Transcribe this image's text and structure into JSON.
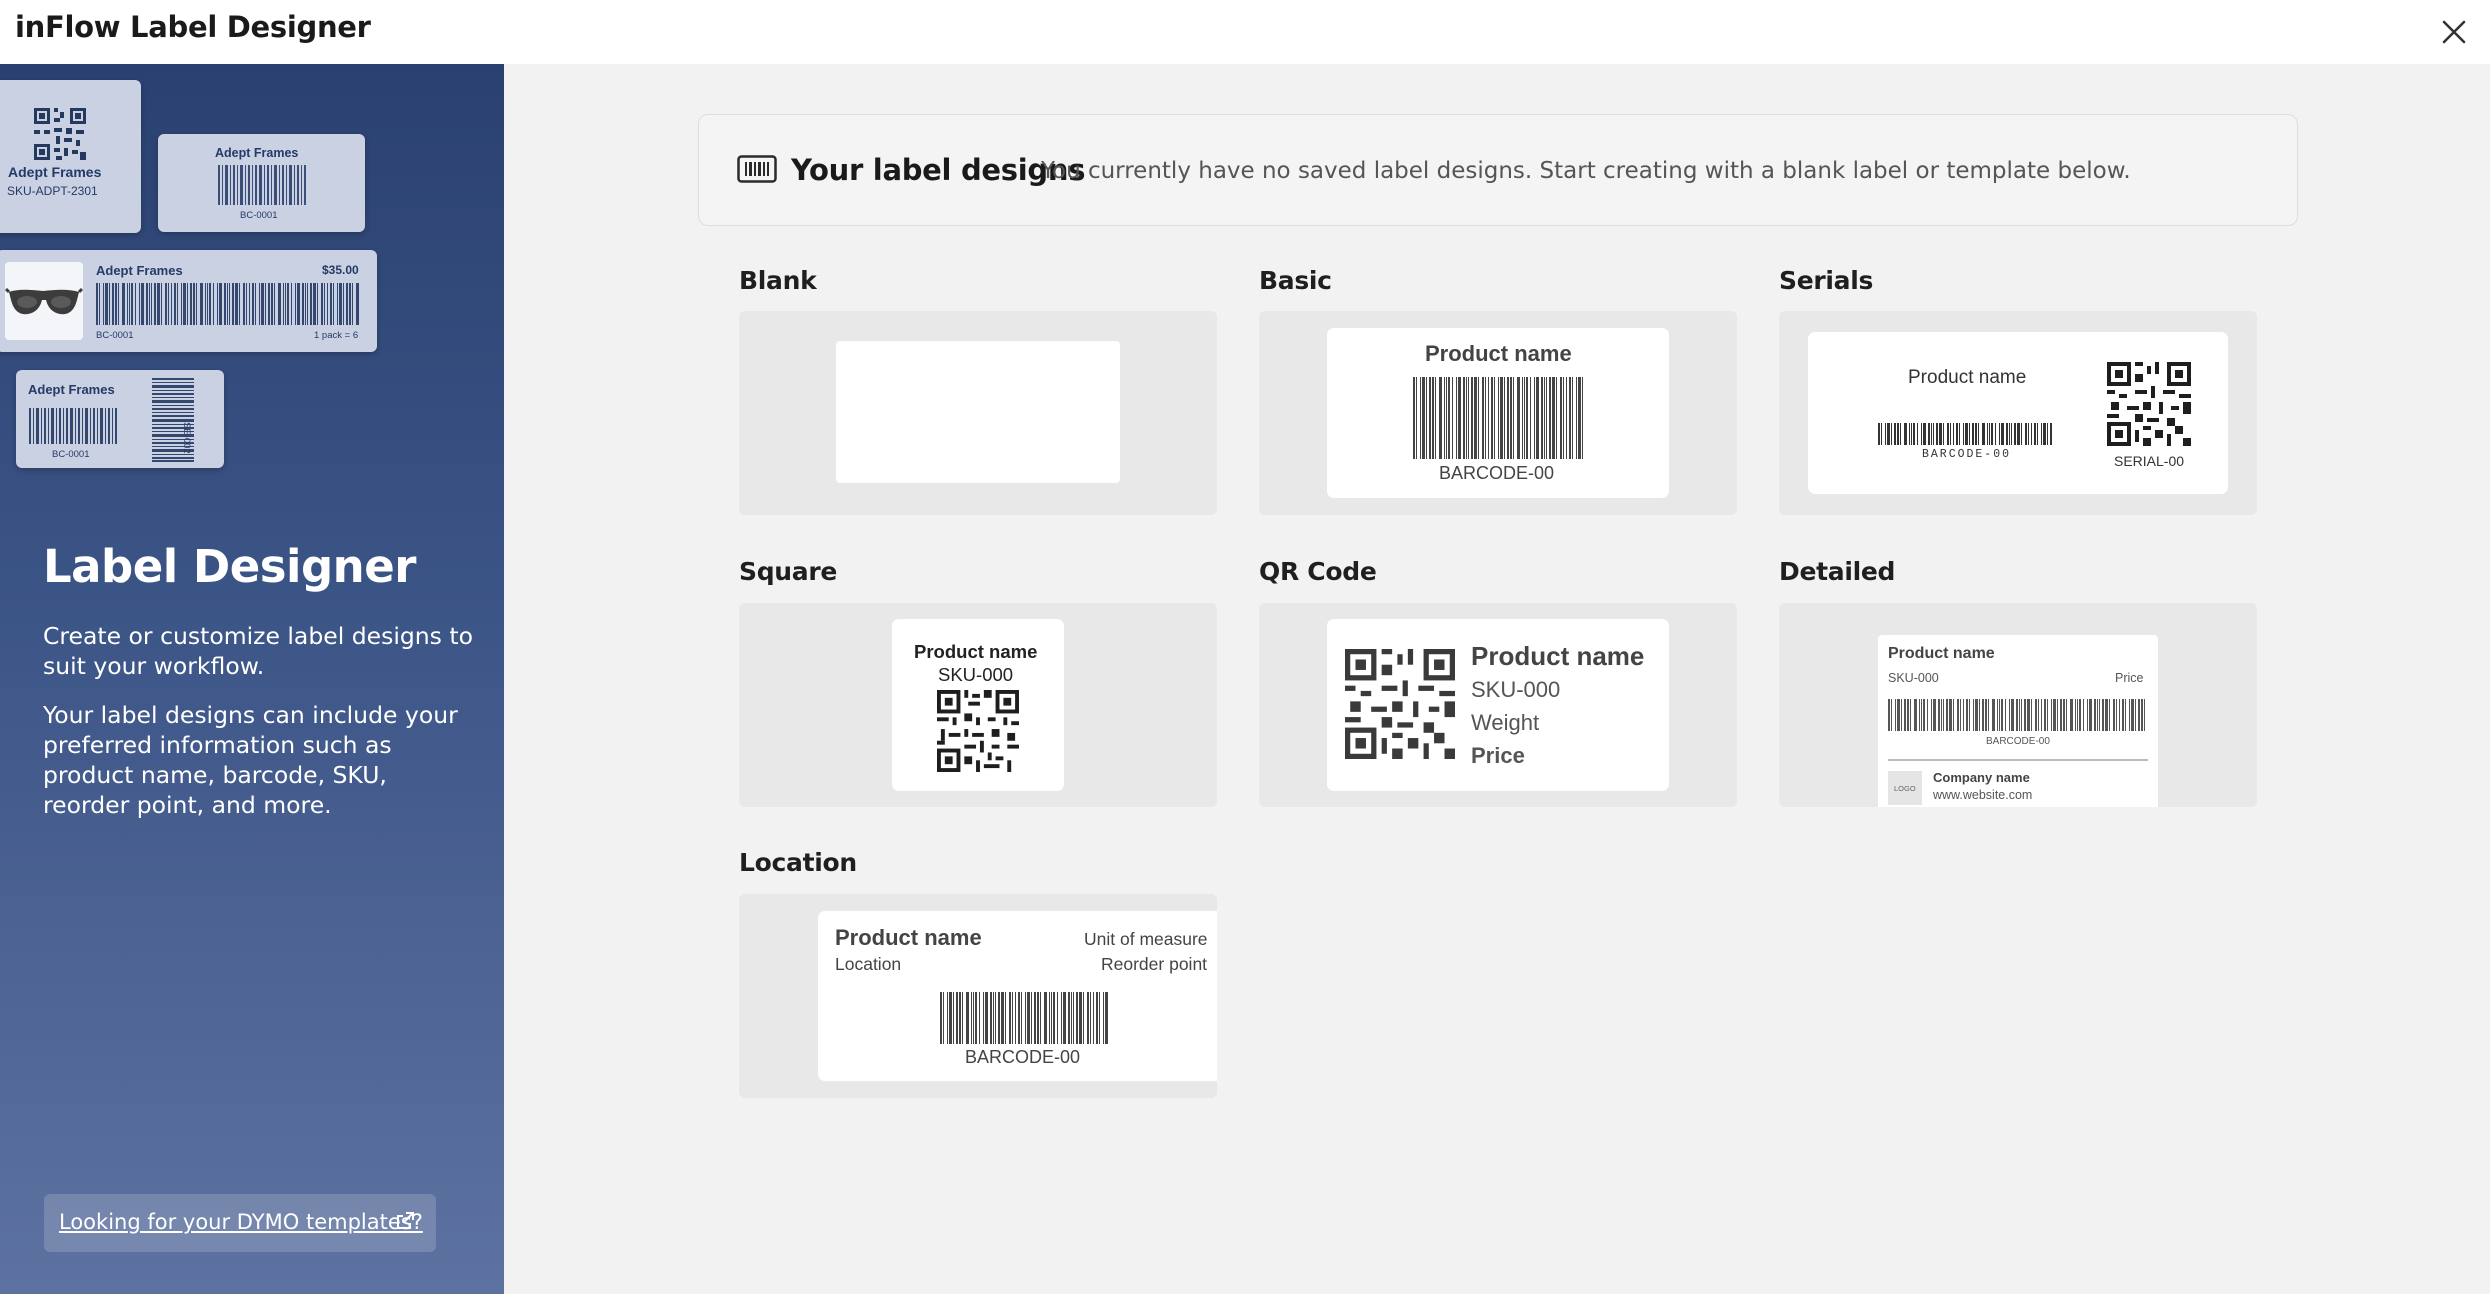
{
  "app": {
    "title": "inFlow Label Designer"
  },
  "icons": {
    "close": "close-icon",
    "barcode": "barcode-icon",
    "external_link": "external-link-icon"
  },
  "sidebar": {
    "preview_labels": {
      "qr_label": {
        "name": "Adept Frames",
        "sku": "SKU-ADPT-2301"
      },
      "barcode_label": {
        "name": "Adept Frames",
        "code": "BC-0001"
      },
      "price_label": {
        "name": "Adept Frames",
        "price": "$35.00",
        "code": "BC-0001",
        "pack": "1 pack = 6"
      },
      "vertical_label": {
        "name": "Adept Frames",
        "code": "BC-0001",
        "side_code": "SE-002"
      }
    },
    "title": "Label Designer",
    "description_1": "Create or customize label designs to suit your workflow.",
    "description_2": "Your label designs can include your preferred information such as product name, barcode, SKU, reorder point, and more.",
    "dymo_link": "Looking for your DYMO templates?"
  },
  "banner": {
    "title": "Your label designs",
    "subtitle": "You currently have no saved label designs. Start creating with a blank label or template below."
  },
  "templates": {
    "blank": {
      "title": "Blank"
    },
    "basic": {
      "title": "Basic",
      "product": "Product name",
      "barcode": "BARCODE-00"
    },
    "serials": {
      "title": "Serials",
      "product": "Product name",
      "barcode": "BARCODE-00",
      "serial": "SERIAL-00"
    },
    "square": {
      "title": "Square",
      "product": "Product name",
      "sku": "SKU-000"
    },
    "qr_code": {
      "title": "QR Code",
      "product": "Product name",
      "sku": "SKU-000",
      "weight": "Weight",
      "price": "Price"
    },
    "detailed": {
      "title": "Detailed",
      "product": "Product name",
      "sku": "SKU-000",
      "price": "Price",
      "barcode": "BARCODE-00",
      "logo": "LOGO",
      "company": "Company name",
      "website": "www.website.com"
    },
    "location": {
      "title": "Location",
      "product": "Product name",
      "unit": "Unit of measure",
      "location": "Location",
      "reorder": "Reorder point",
      "barcode": "BARCODE-00"
    }
  }
}
